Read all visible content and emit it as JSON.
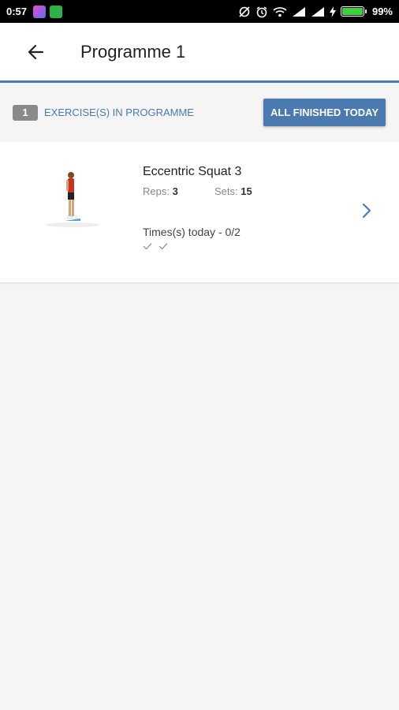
{
  "status_bar": {
    "time": "0:57",
    "battery": "99%",
    "battery_level": 0.99
  },
  "header": {
    "title": "Programme 1"
  },
  "info_bar": {
    "count": "1",
    "label": "EXERCISE(S) IN PROGRAMME",
    "finish_button": "ALL FINISHED TODAY"
  },
  "exercise": {
    "name": "Eccentric Squat 3",
    "reps_label": "Reps:",
    "reps_value": "3",
    "sets_label": "Sets:",
    "sets_value": "15",
    "today_text": "Times(s) today - 0/2",
    "checks": [
      "check-icon",
      "check-icon"
    ]
  },
  "colors": {
    "accent": "#4a7ab0",
    "badge": "#8a8a8a",
    "background": "#f5f5f5"
  }
}
